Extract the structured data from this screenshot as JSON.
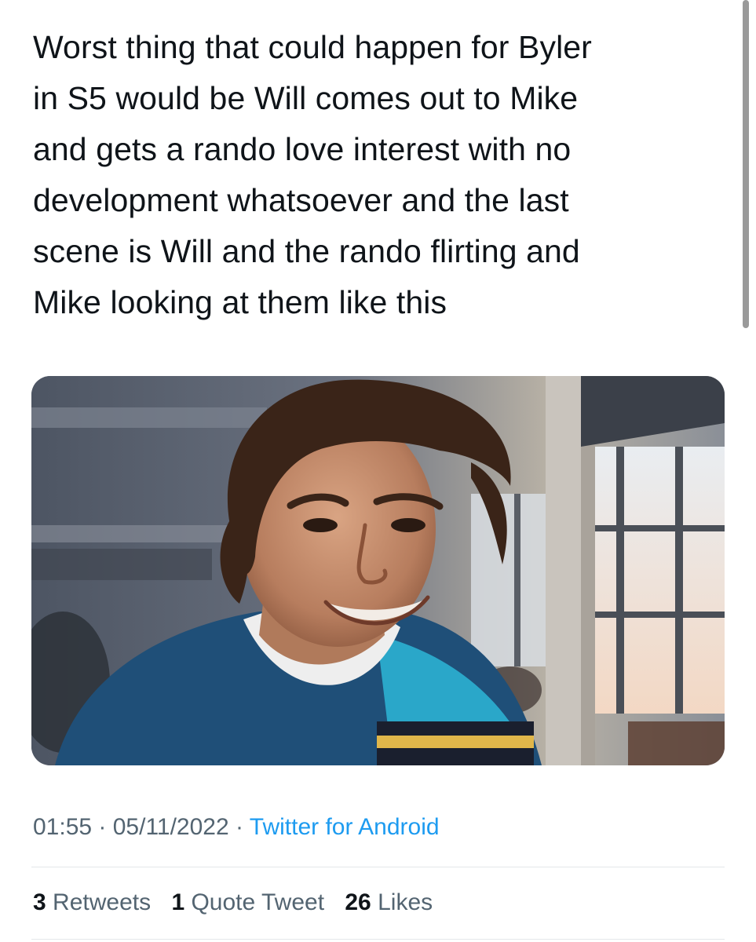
{
  "tweet": {
    "text_lines": [
      "Worst thing that could happen for Byler",
      "in S5 would be Will comes out to Mike",
      "and gets a rando love interest with no",
      "development whatsoever and the last",
      "scene is Will and the rando flirting and",
      "Mike looking at them like this"
    ],
    "media": {
      "kind": "photo"
    },
    "meta": {
      "time": "01:55",
      "separator": " · ",
      "date": "05/11/2022",
      "source": "Twitter for Android"
    },
    "stats": {
      "retweets_count": "3",
      "retweets_label": "Retweets",
      "quotes_count": "1",
      "quotes_label": "Quote Tweet",
      "likes_count": "26",
      "likes_label": "Likes"
    }
  },
  "colors": {
    "text": "#0f1419",
    "secondary": "#536471",
    "link": "#1d9bf0",
    "divider": "#e4e7ea"
  }
}
